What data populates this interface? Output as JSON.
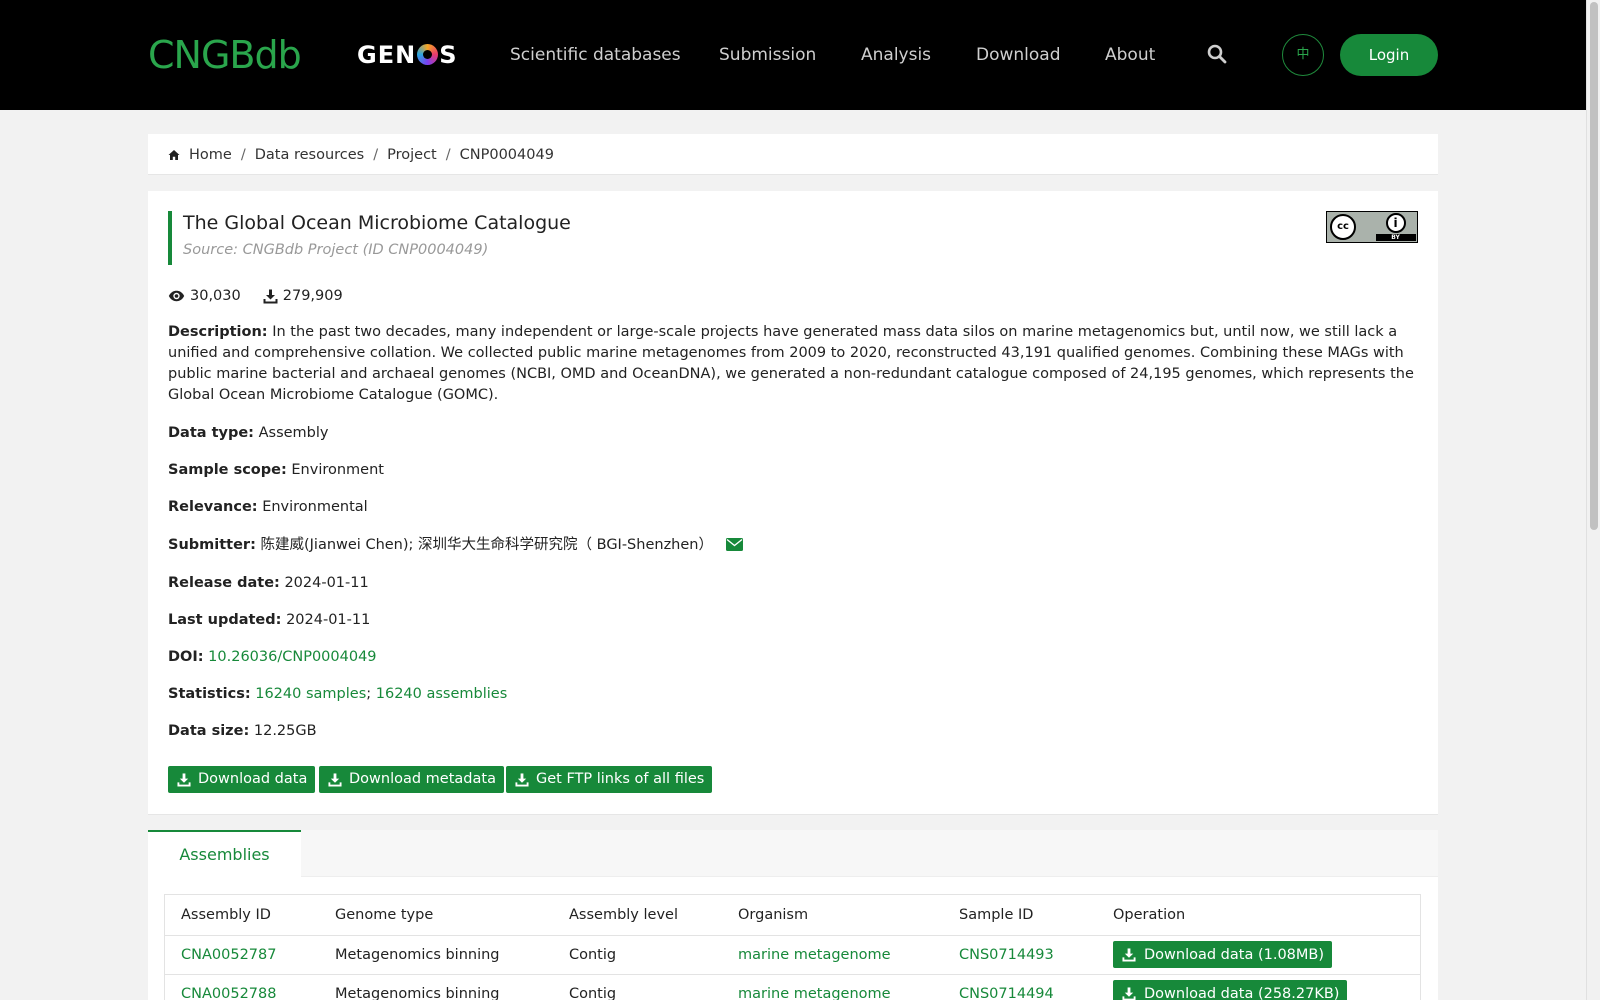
{
  "header": {
    "logo_cngb": "CNGBdb",
    "logo_genos_pre": "GEN",
    "logo_genos_post": "S",
    "nav": [
      "Scientific databases",
      "Submission",
      "Analysis",
      "Download",
      "About"
    ],
    "lang_label": "中",
    "login_label": "Login"
  },
  "breadcrumb": {
    "items": [
      "Home",
      "Data resources",
      "Project",
      "CNP0004049"
    ],
    "separator": "/"
  },
  "project": {
    "title": "The Global Ocean Microbiome Catalogue",
    "source": "Source: CNGBdb Project (ID CNP0004049)",
    "license_cc": "cc",
    "license_by": "BY",
    "views": "30,030",
    "downloads": "279,909",
    "description_label": "Description:",
    "description": "In the past two decades, many independent or large-scale projects have generated mass data silos on marine metagenomics but, until now, we still lack a unified and comprehensive collation. We collected public marine metagenomes from 2009 to 2020, reconstructed 43,191 qualified genomes. Combining these MAGs with public marine bacterial and archaeal genomes (NCBI, OMD and OceanDNA), we generated a non-redundant catalogue composed of 24,195 genomes, which represents the Global Ocean Microbiome Catalogue (GOMC).",
    "data_type_label": "Data type:",
    "data_type": "Assembly",
    "sample_scope_label": "Sample scope:",
    "sample_scope": "Environment",
    "relevance_label": "Relevance:",
    "relevance": "Environmental",
    "submitter_label": "Submitter:",
    "submitter": "陈建威(Jianwei Chen); 深圳华大生命科学研究院（ BGI-Shenzhen）",
    "release_label": "Release date:",
    "release_date": "2024-01-11",
    "updated_label": "Last updated:",
    "updated_date": "2024-01-11",
    "doi_label": "DOI:",
    "doi": "10.26036/CNP0004049",
    "statistics_label": "Statistics:",
    "samples_link": "16240 samples",
    "stats_sep": ";",
    "assemblies_link": "16240 assemblies",
    "data_size_label": "Data size:",
    "data_size": "12.25GB",
    "btn_download_data": "Download data",
    "btn_download_metadata": "Download metadata",
    "btn_ftp": "Get FTP links of all files"
  },
  "tabs": {
    "active": "Assemblies"
  },
  "table": {
    "columns": [
      "Assembly ID",
      "Genome type",
      "Assembly level",
      "Organism",
      "Sample ID",
      "Operation"
    ],
    "rows": [
      {
        "assembly_id": "CNA0052787",
        "genome_type": "Metagenomics binning",
        "level": "Contig",
        "organism": "marine metagenome",
        "sample_id": "CNS0714493",
        "op": "Download data (1.08MB)"
      },
      {
        "assembly_id": "CNA0052788",
        "genome_type": "Metagenomics binning",
        "level": "Contig",
        "organism": "marine metagenome",
        "sample_id": "CNS0714494",
        "op": "Download data (258.27KB)"
      }
    ]
  },
  "colors": {
    "brand_green": "#17893a",
    "nav_bg": "#000000"
  }
}
